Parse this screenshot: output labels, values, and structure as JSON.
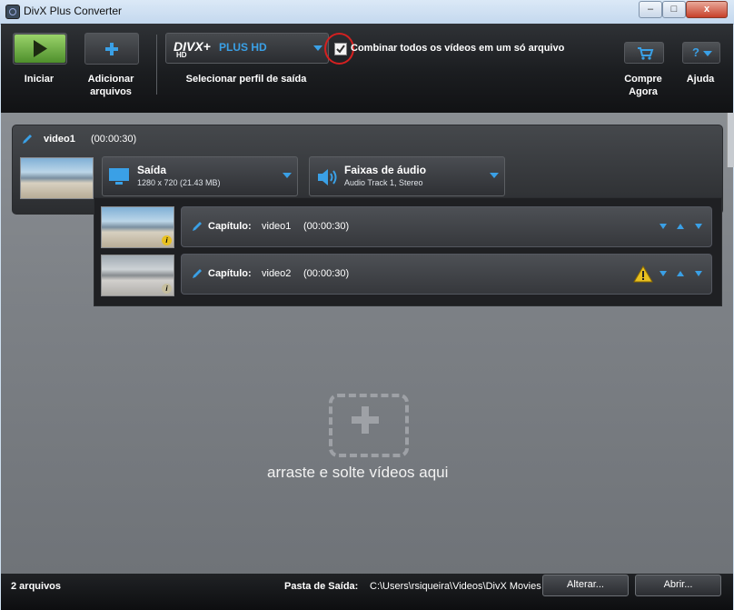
{
  "window": {
    "title": "DivX Plus Converter",
    "minimize": "–",
    "maximize": "□",
    "close": "x"
  },
  "toolbar": {
    "start_label": "Iniciar",
    "add_label": "Adicionar arquivos",
    "profile_logo": "DIVX+",
    "profile_logo_sub": "HD",
    "profile_name": "PLUS HD",
    "profile_caption": "Selecionar perfil de saída",
    "combine_label": "Combinar todos os vídeos em um só arquivo",
    "combine_checked": true,
    "buy_label": "Compre Agora",
    "help_label": "Ajuda",
    "help_icon": "?"
  },
  "file": {
    "name": "video1",
    "duration": "(00:00:30)",
    "output_title": "Saída",
    "output_detail": "1280 x 720 (21.43 MB)",
    "audio_title": "Faixas de áudio",
    "audio_detail": "Audio Track 1, Stereo",
    "chapters": [
      {
        "prefix": "Capítulo:",
        "name": "video1",
        "duration": "(00:00:30)",
        "warning": false
      },
      {
        "prefix": "Capítulo:",
        "name": "video2",
        "duration": "(00:00:30)",
        "warning": true
      }
    ]
  },
  "dropzone": {
    "text": "arraste e solte vídeos aqui",
    "icon": "add-plus-icon"
  },
  "footer": {
    "count": "2 arquivos",
    "folder_label": "Pasta de Saída:",
    "folder_path": "C:\\Users\\rsiqueira\\Videos\\DivX Movies",
    "change_button": "Alterar...",
    "open_button": "Abrir..."
  },
  "colors": {
    "accent_blue": "#3aa0e6",
    "play_green": "#6ab04c",
    "warning": "#e8c020"
  }
}
